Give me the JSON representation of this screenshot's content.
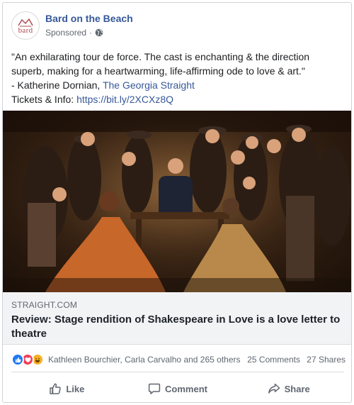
{
  "post": {
    "page_name": "Bard on the Beach",
    "avatar_text": "bard",
    "sponsored_label": "Sponsored",
    "meta_separator": "·",
    "body_lines": [
      "\"An exhilarating tour de force. The cast is enchanting & the direction",
      "superb, making for a heartwarming, life-affirming ode to love & art.\""
    ],
    "attribution_prefix": "- Katherine Dornian, ",
    "attribution_link": "The Georgia Straight",
    "tickets_prefix": "Tickets & Info: ",
    "tickets_link": "https://bit.ly/2XCXz8Q"
  },
  "link_preview": {
    "domain": "STRAIGHT.COM",
    "headline": "Review: Stage rendition of Shakespeare in Love is a love letter to theatre"
  },
  "engagement": {
    "reaction_icons": [
      "like-icon",
      "love-icon",
      "haha-icon"
    ],
    "reaction_names": "Kathleen Bourchier, Carla Carvalho and 265 others",
    "comments": "25 Comments",
    "shares": "27 Shares"
  },
  "actions": {
    "like": "Like",
    "comment": "Comment",
    "share": "Share"
  },
  "colors": {
    "link_blue": "#365899",
    "like_blue": "#2078f4",
    "love_red": "#f33e58",
    "haha_yellow": "#f7b125",
    "preview_bg": "#f2f3f5",
    "muted_text": "#606770"
  }
}
